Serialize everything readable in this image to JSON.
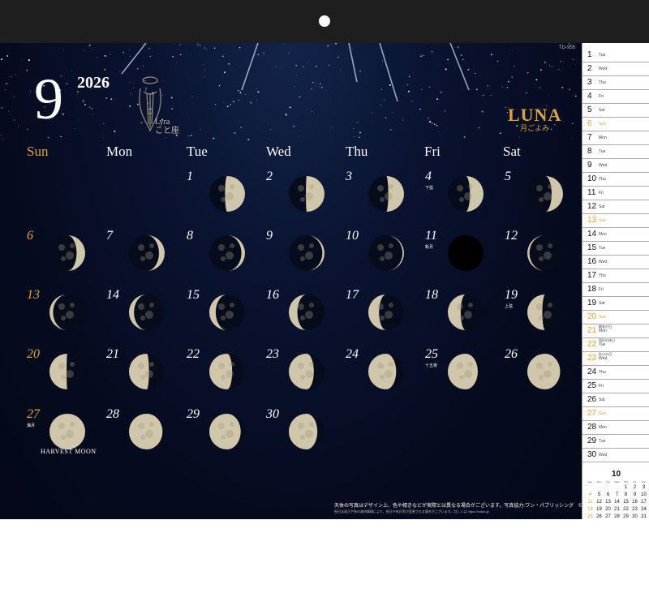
{
  "month_number": "9",
  "year": "2026",
  "product_code": "TD-955",
  "constellation": {
    "name": "Lyra",
    "name_jp": "こと座"
  },
  "brand": {
    "title": "LUNA",
    "subtitle": "月ごよみ"
  },
  "weekdays": [
    "Sun",
    "Mon",
    "Tue",
    "Wed",
    "Thu",
    "Fri",
    "Sat"
  ],
  "days": [
    {
      "d": "1",
      "col": 2,
      "row": 0,
      "phase": 0.78
    },
    {
      "d": "2",
      "col": 3,
      "row": 0,
      "phase": 0.76
    },
    {
      "d": "3",
      "col": 4,
      "row": 0,
      "phase": 0.72
    },
    {
      "d": "4",
      "col": 5,
      "row": 0,
      "phase": 0.69,
      "note": "下弦"
    },
    {
      "d": "5",
      "col": 6,
      "row": 0,
      "phase": 0.66
    },
    {
      "d": "6",
      "col": 0,
      "row": 1,
      "phase": 0.62
    },
    {
      "d": "7",
      "col": 1,
      "row": 1,
      "phase": 0.58
    },
    {
      "d": "8",
      "col": 2,
      "row": 1,
      "phase": 0.55
    },
    {
      "d": "9",
      "col": 3,
      "row": 1,
      "phase": 0.53
    },
    {
      "d": "10",
      "col": 4,
      "row": 1,
      "phase": 0.52
    },
    {
      "d": "11",
      "col": 5,
      "row": 1,
      "phase": 0.5,
      "note": "新月"
    },
    {
      "d": "12",
      "col": 6,
      "row": 1,
      "phase": 0.47
    },
    {
      "d": "13",
      "col": 0,
      "row": 2,
      "phase": 0.45
    },
    {
      "d": "14",
      "col": 1,
      "row": 2,
      "phase": 0.43
    },
    {
      "d": "15",
      "col": 2,
      "row": 2,
      "phase": 0.41
    },
    {
      "d": "16",
      "col": 3,
      "row": 2,
      "phase": 0.38
    },
    {
      "d": "17",
      "col": 4,
      "row": 2,
      "phase": 0.35
    },
    {
      "d": "18",
      "col": 5,
      "row": 2,
      "phase": 0.32
    },
    {
      "d": "19",
      "col": 6,
      "row": 2,
      "phase": 0.29,
      "note": "上弦"
    },
    {
      "d": "20",
      "col": 0,
      "row": 3,
      "phase": 0.26
    },
    {
      "d": "21",
      "col": 1,
      "row": 3,
      "phase": 0.22
    },
    {
      "d": "22",
      "col": 2,
      "row": 3,
      "phase": 0.18
    },
    {
      "d": "23",
      "col": 3,
      "row": 3,
      "phase": 0.15
    },
    {
      "d": "24",
      "col": 4,
      "row": 3,
      "phase": 0.11
    },
    {
      "d": "25",
      "col": 5,
      "row": 3,
      "phase": 0.08,
      "note": "十五夜"
    },
    {
      "d": "26",
      "col": 6,
      "row": 3,
      "phase": 0.04
    },
    {
      "d": "27",
      "col": 0,
      "row": 4,
      "phase": 0.0,
      "note": "満月"
    },
    {
      "d": "28",
      "col": 1,
      "row": 4,
      "phase": 0.03
    },
    {
      "d": "29",
      "col": 2,
      "row": 4,
      "phase": 0.06
    },
    {
      "d": "30",
      "col": 3,
      "row": 4,
      "phase": 0.1
    }
  ],
  "harvest_label": "HARVEST MOON",
  "footer_line1": "天体の写真はデザイン上、色や傾きなどが実際とは異なる場合がございます。写真協力:ワン・パブリッシング　© TODAN",
  "footer_line2": "祝日法改正や急の政府事情により、祝日や休日等が変更される場合がございます。詳しくは https://todan.jp",
  "strip_days": [
    {
      "n": "1",
      "w": "Tue"
    },
    {
      "n": "2",
      "w": "Wed"
    },
    {
      "n": "3",
      "w": "Thu"
    },
    {
      "n": "4",
      "w": "Fri"
    },
    {
      "n": "5",
      "w": "Sat"
    },
    {
      "n": "6",
      "w": "Sun",
      "sun": true
    },
    {
      "n": "7",
      "w": "Mon"
    },
    {
      "n": "8",
      "w": "Tue"
    },
    {
      "n": "9",
      "w": "Wed"
    },
    {
      "n": "10",
      "w": "Thu"
    },
    {
      "n": "11",
      "w": "Fri"
    },
    {
      "n": "12",
      "w": "Sat"
    },
    {
      "n": "13",
      "w": "Sun",
      "sun": true
    },
    {
      "n": "14",
      "w": "Mon"
    },
    {
      "n": "15",
      "w": "Tue"
    },
    {
      "n": "16",
      "w": "Wed"
    },
    {
      "n": "17",
      "w": "Thu"
    },
    {
      "n": "18",
      "w": "Fri"
    },
    {
      "n": "19",
      "w": "Sat"
    },
    {
      "n": "20",
      "w": "Sun",
      "sun": true
    },
    {
      "n": "21",
      "w": "Mon",
      "note": "敬老の日",
      "hol": true
    },
    {
      "n": "22",
      "w": "Tue",
      "note": "国民の休日",
      "hol": true
    },
    {
      "n": "23",
      "w": "Wed",
      "note": "秋分の日",
      "hol": true
    },
    {
      "n": "24",
      "w": "Thu"
    },
    {
      "n": "25",
      "w": "Fri"
    },
    {
      "n": "26",
      "w": "Sat"
    },
    {
      "n": "27",
      "w": "Sun",
      "sun": true
    },
    {
      "n": "28",
      "w": "Mon"
    },
    {
      "n": "29",
      "w": "Tue"
    },
    {
      "n": "30",
      "w": "Wed"
    }
  ],
  "mini_calendar": {
    "month": "10",
    "headers": [
      "Sun",
      "Mon",
      "Tue",
      "Wed",
      "Thu",
      "Fri",
      "Sat"
    ],
    "weeks": [
      [
        "",
        "",
        "",
        "",
        "1",
        "2",
        "3"
      ],
      [
        "4",
        "5",
        "6",
        "7",
        "8",
        "9",
        "10"
      ],
      [
        "11",
        "12",
        "13",
        "14",
        "15",
        "16",
        "17"
      ],
      [
        "18",
        "19",
        "20",
        "21",
        "22",
        "23",
        "24"
      ],
      [
        "25",
        "26",
        "27",
        "28",
        "29",
        "30",
        "31"
      ]
    ]
  }
}
